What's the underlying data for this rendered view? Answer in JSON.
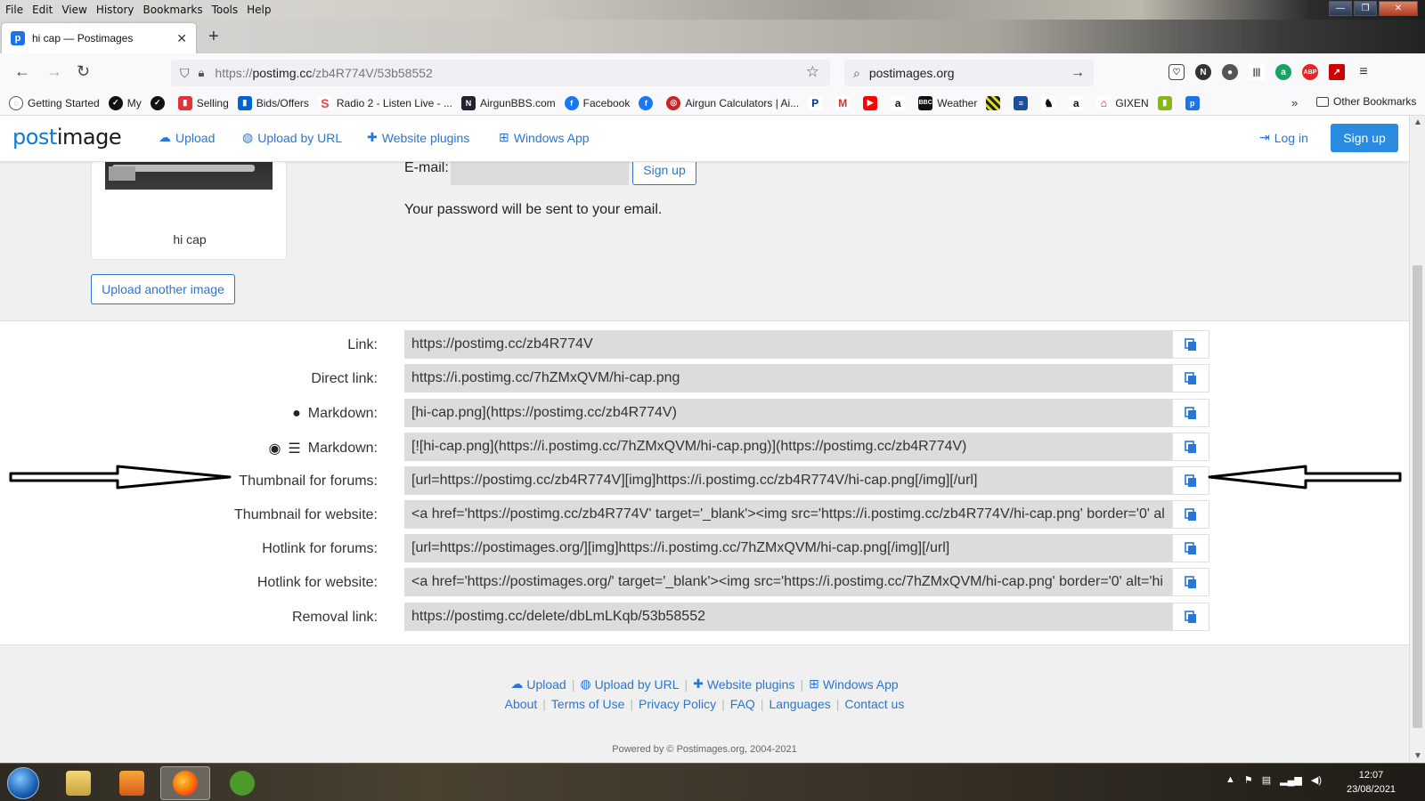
{
  "browser": {
    "menu": [
      "File",
      "Edit",
      "View",
      "History",
      "Bookmarks",
      "Tools",
      "Help"
    ],
    "tab_title": "hi cap — Postimages",
    "url_prefix": "https://",
    "url_host": "postimg.cc",
    "url_path": "/zb4R774V/53b58552",
    "search_text": "postimages.org",
    "bookmarks": [
      "Getting Started",
      "My",
      "",
      "Selling",
      "Bids/Offers",
      "Radio 2 - Listen Live - ...",
      "AirgunBBS.com",
      "Facebook",
      "",
      "Airgun Calculators | Ai...",
      "",
      "",
      "",
      "",
      "Weather",
      "",
      "",
      "",
      "",
      "GIXEN",
      "",
      ""
    ],
    "other_bookmarks": "Other Bookmarks"
  },
  "header": {
    "logo_a": "post",
    "logo_b": "image",
    "nav": [
      "Upload",
      "Upload by URL",
      "Website plugins",
      "Windows App"
    ],
    "login": "Log in",
    "signup": "Sign up"
  },
  "thumbnail": {
    "caption": "hi cap"
  },
  "register": {
    "email_label": "E-mail:",
    "email_value": "",
    "signup_button": "Sign up",
    "note": "Your password will be sent to your email."
  },
  "upload_another": "Upload another image",
  "codes": [
    {
      "label": "Link:",
      "value": "https://postimg.cc/zb4R774V"
    },
    {
      "label": "Direct link:",
      "value": "https://i.postimg.cc/7hZMxQVM/hi-cap.png"
    },
    {
      "label": "Markdown:",
      "value": "[hi-cap.png](https://postimg.cc/zb4R774V)"
    },
    {
      "label": "Markdown:",
      "value": "[![hi-cap.png](https://i.postimg.cc/7hZMxQVM/hi-cap.png)](https://postimg.cc/zb4R774V)"
    },
    {
      "label": "Thumbnail for forums:",
      "value": "[url=https://postimg.cc/zb4R774V][img]https://i.postimg.cc/zb4R774V/hi-cap.png[/img][/url]"
    },
    {
      "label": "Thumbnail for website:",
      "value": "<a href='https://postimg.cc/zb4R774V' target='_blank'><img src='https://i.postimg.cc/zb4R774V/hi-cap.png' border='0' al"
    },
    {
      "label": "Hotlink for forums:",
      "value": "[url=https://postimages.org/][img]https://i.postimg.cc/7hZMxQVM/hi-cap.png[/img][/url]"
    },
    {
      "label": "Hotlink for website:",
      "value": "<a href='https://postimages.org/' target='_blank'><img src='https://i.postimg.cc/7hZMxQVM/hi-cap.png' border='0' alt='hi"
    },
    {
      "label": "Removal link:",
      "value": "https://postimg.cc/delete/dbLmLKqb/53b58552"
    }
  ],
  "footer": {
    "row1": [
      "Upload",
      "Upload by URL",
      "Website plugins",
      "Windows App"
    ],
    "row2": [
      "About",
      "Terms of Use",
      "Privacy Policy",
      "FAQ",
      "Languages",
      "Contact us"
    ],
    "powered": "Powered by © Postimages.org, 2004-2021"
  },
  "taskbar": {
    "time": "12:07",
    "date": "23/08/2021"
  },
  "colors": {
    "accent": "#2a76d2",
    "button_blue": "#2a8be0",
    "field_gray": "#dcdcdc"
  }
}
